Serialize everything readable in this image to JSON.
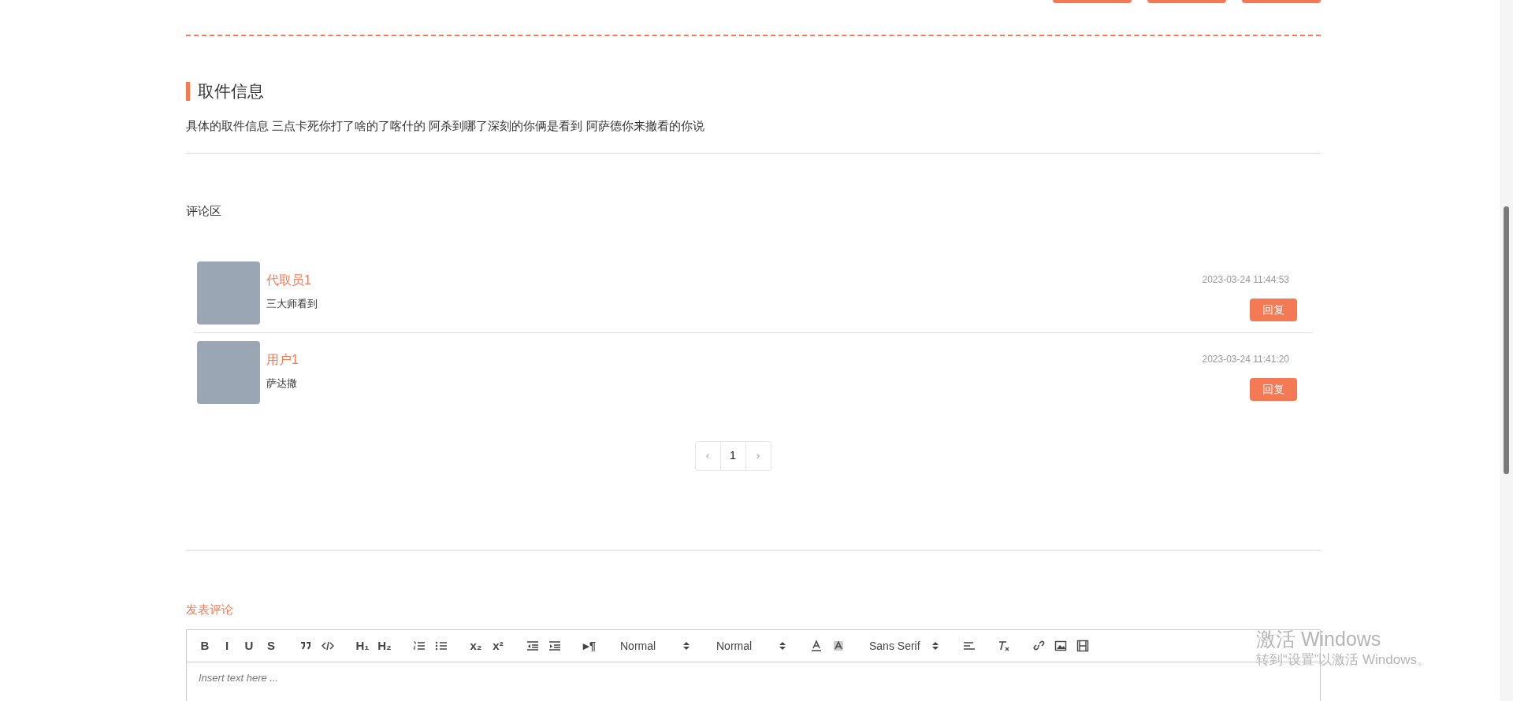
{
  "top_actions": [
    {
      "kind": "button"
    },
    {
      "kind": "button"
    },
    {
      "kind": "button"
    }
  ],
  "pickup_info": {
    "title": "取件信息",
    "description": "具体的取件信息 三点卡死你打了啥的了喀什的 阿杀到哪了深刻的你俩是看到 阿萨德你来撤看的你说"
  },
  "comments_section": {
    "title": "评论区",
    "comments": [
      {
        "author": "代取员1",
        "text": "三大师看到",
        "time": "2023-03-24 11:44:53",
        "reply_button": "回复"
      },
      {
        "author": "用户1",
        "text": "萨达撒",
        "time": "2023-03-24 11:41:20",
        "reply_button": "回复"
      }
    ],
    "pagination": {
      "prev": "‹",
      "pages": [
        {
          "label": "1",
          "selected": true
        }
      ],
      "next": "›"
    }
  },
  "post_comment": {
    "title": "发表评论",
    "toolbar": [
      [
        {
          "kind": "text",
          "label": "B"
        },
        {
          "kind": "text",
          "label": "I"
        },
        {
          "kind": "text",
          "label": "U"
        },
        {
          "kind": "text",
          "label": "S"
        }
      ],
      [
        {
          "kind": "icon"
        },
        {
          "kind": "icon"
        }
      ],
      [
        {
          "kind": "text",
          "label": "H₁"
        },
        {
          "kind": "text",
          "label": "H₂"
        }
      ],
      [
        {
          "kind": "icon"
        },
        {
          "kind": "icon"
        }
      ],
      [
        {
          "kind": "text",
          "label": "x₂"
        },
        {
          "kind": "text",
          "label": "x²"
        }
      ],
      [
        {
          "kind": "icon"
        },
        {
          "kind": "icon"
        }
      ],
      [
        {
          "kind": "text",
          "label": "▸¶"
        }
      ],
      [
        {
          "kind": "select",
          "value": "Normal"
        }
      ],
      [
        {
          "kind": "select",
          "value": "Normal"
        }
      ],
      [
        {
          "kind": "icon"
        },
        {
          "kind": "icon"
        }
      ],
      [
        {
          "kind": "select",
          "value": "Sans Serif"
        }
      ],
      [
        {
          "kind": "icon"
        }
      ],
      [
        {
          "kind": "icon"
        }
      ],
      [
        {
          "kind": "icon"
        },
        {
          "kind": "icon"
        },
        {
          "kind": "icon"
        }
      ]
    ],
    "editor": {
      "placeholder": "Insert text here ..."
    }
  },
  "os_overlay": {
    "title": "激活 Windows",
    "subtitle": "转到“设置”以激活 Windows。"
  }
}
